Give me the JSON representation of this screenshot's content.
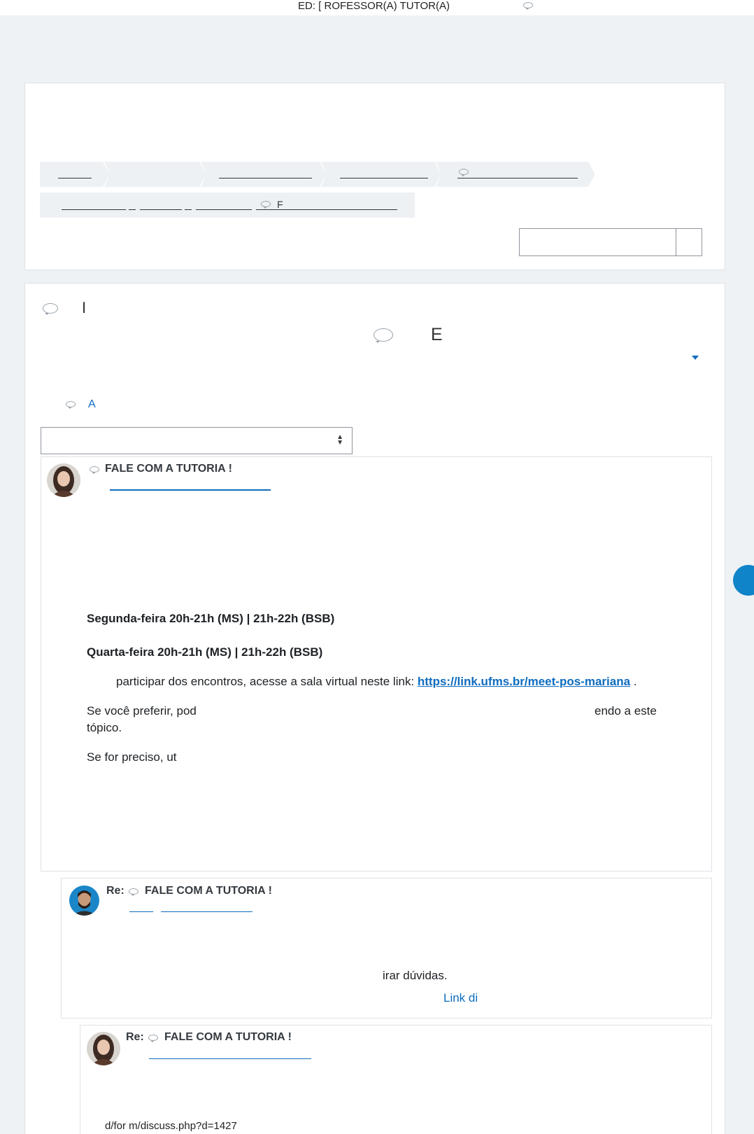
{
  "topbar": {
    "title": "ED: [   ROFESSOR(A) TUTOR(A)"
  },
  "breadcrumb": {
    "item_f": "F"
  },
  "forum_header": {
    "left_text": "I",
    "center_text": "E",
    "link_text": "A"
  },
  "posts": [
    {
      "subject": "FALE COM A TUTORIA !",
      "lines": {
        "monday": "Segunda-feira 20h-21h (MS) | 21h-22h (BSB)",
        "wednesday": "Quarta-feira 20h-21h (MS) | 21h-22h (BSB)",
        "participate_prefix": "participar dos encontros, acesse a sala virtual neste link: ",
        "meet_link": "https://link.ufms.br/meet-pos-mariana",
        "participate_suffix": " .",
        "prefer_start": "Se você preferir, pod",
        "prefer_end": "endo a este",
        "prefer_topic": "tópico.",
        "needed": "Se for preciso, ut"
      }
    },
    {
      "re_label": "Re:",
      "subject": "FALE COM A TUTORIA !",
      "lines": {
        "doubts": "irar dúvidas.",
        "link_partial": "Link di"
      }
    },
    {
      "re_label": "Re:",
      "subject": "FALE COM A TUTORIA !"
    }
  ],
  "footer": {
    "url": "d/for  m/discuss.php?d=1427"
  }
}
